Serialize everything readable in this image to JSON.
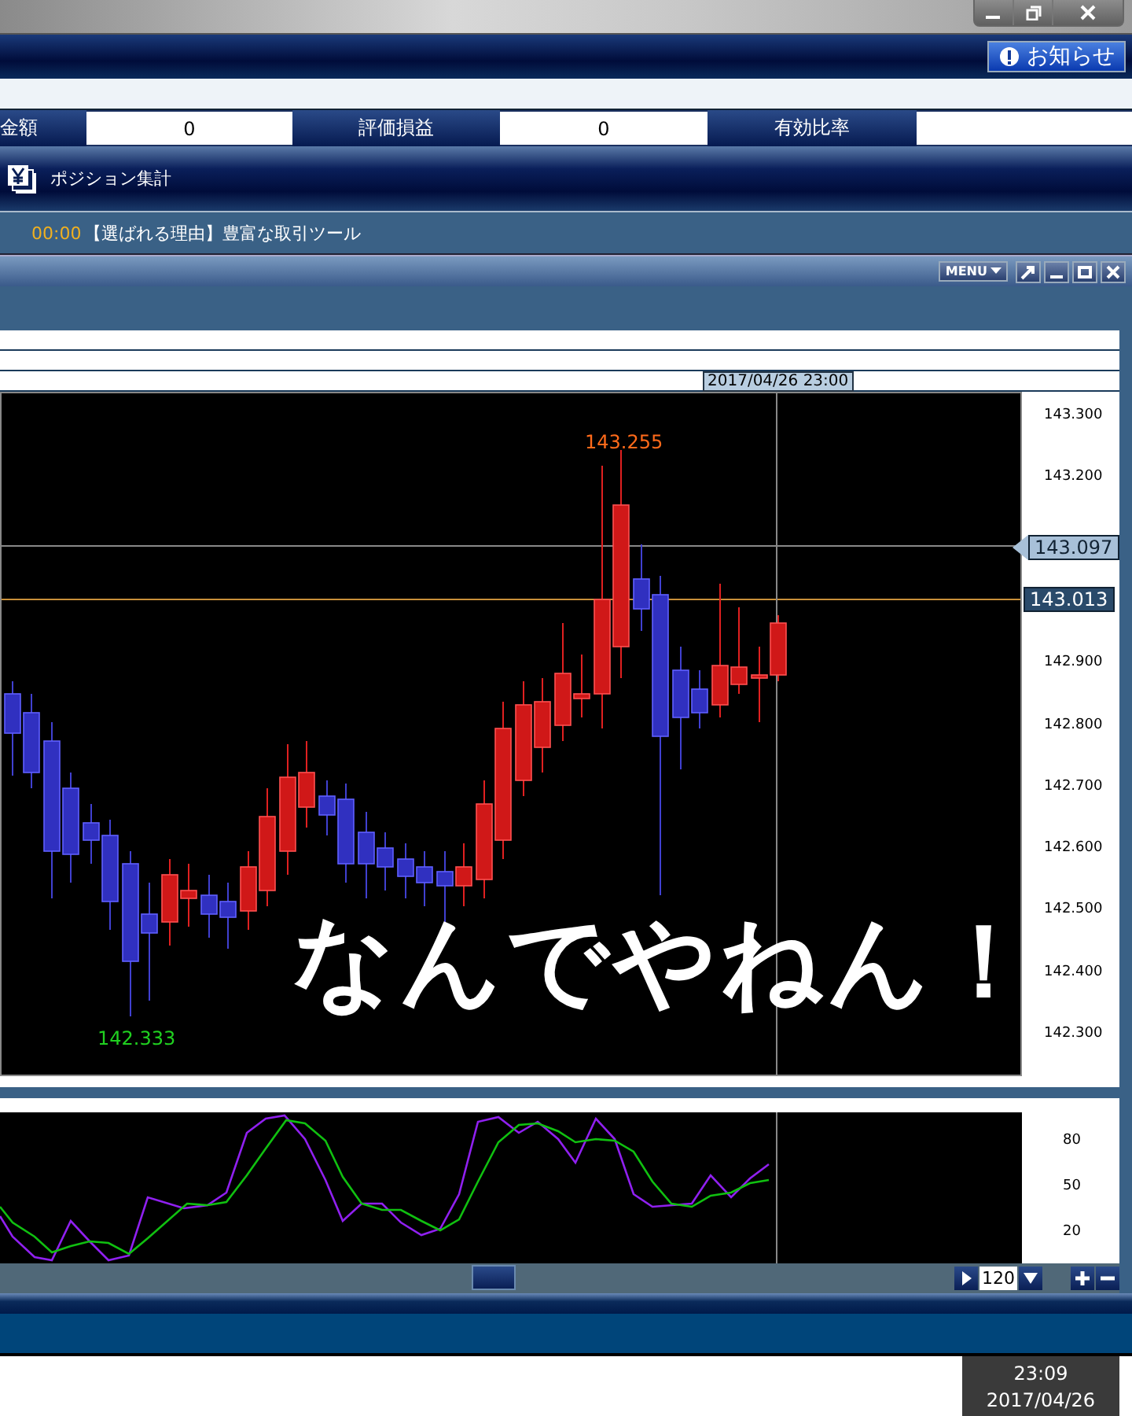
{
  "header": {
    "notice_button": "お知らせ"
  },
  "summary": [
    {
      "label": "金額",
      "value": "0"
    },
    {
      "label": "評価損益",
      "value": "0"
    },
    {
      "label": "有効比率"
    }
  ],
  "panel_title": "ポジション集計",
  "news": {
    "time": "00:00",
    "headline": "【選ばれる理由】豊富な取引ツール"
  },
  "chart_window": {
    "menu_button": "MENU"
  },
  "chart": {
    "cursor_time": "2017/04/26 23:00",
    "high_label": "143.255",
    "low_label": "142.333",
    "price_axis": [
      "143.300",
      "143.200",
      "142.900",
      "142.800",
      "142.700",
      "142.600",
      "142.500",
      "142.400",
      "142.300"
    ],
    "price_tags": [
      {
        "kind": "arrow",
        "value": "143.097"
      },
      {
        "kind": "box",
        "value": "143.013"
      }
    ],
    "caption": "なんでやねん！"
  },
  "oscillator": {
    "axis": [
      "80",
      "50",
      "20"
    ]
  },
  "bar_count": "120",
  "clock": {
    "time": "23:09",
    "date": "2017/04/26"
  }
}
